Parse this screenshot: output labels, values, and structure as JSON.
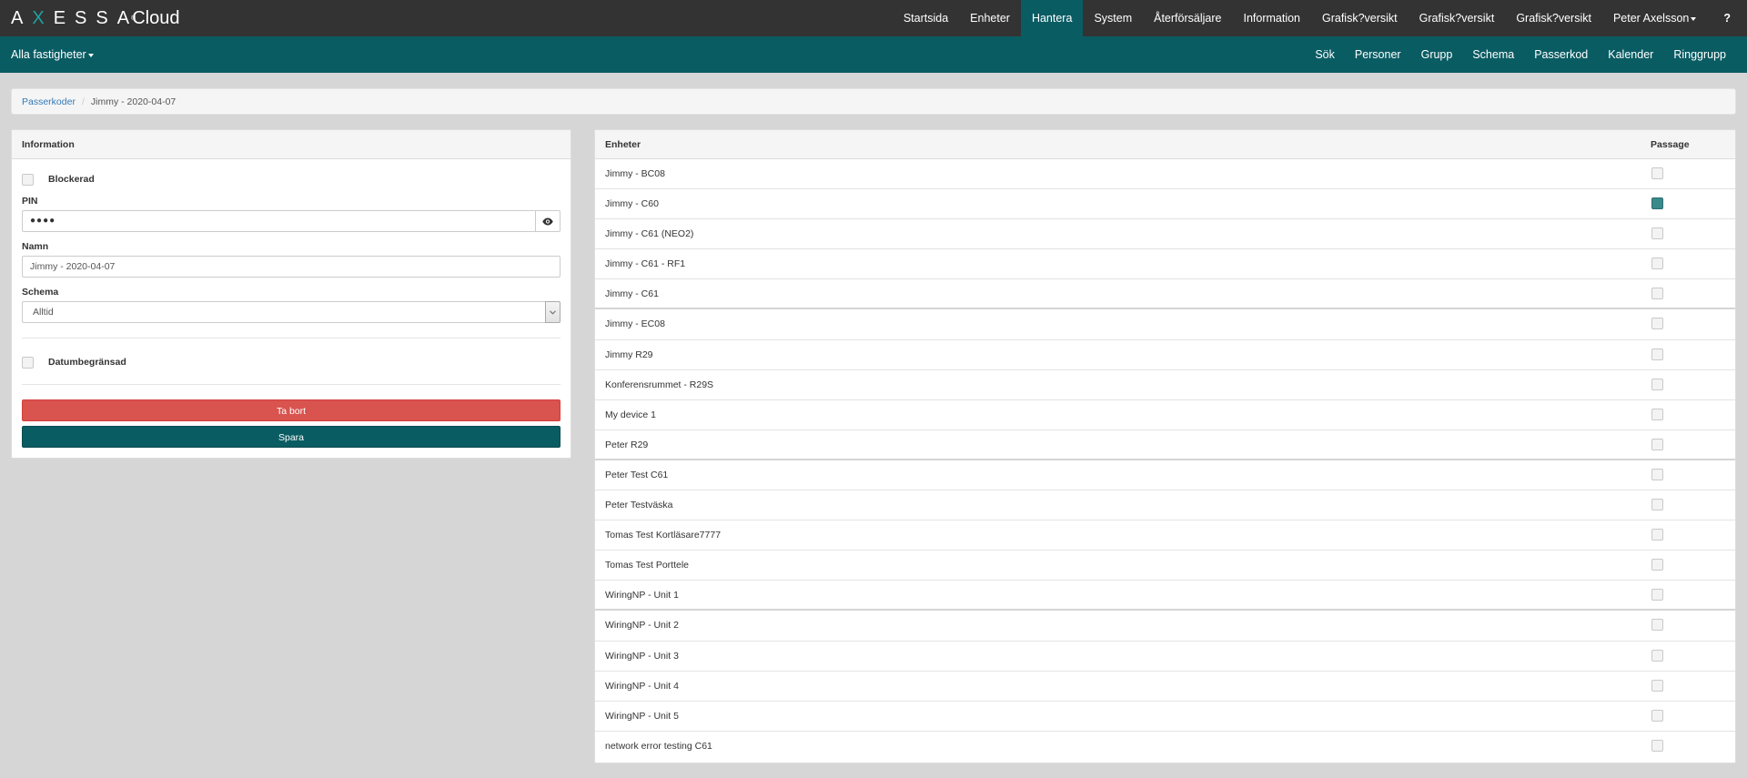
{
  "brand": {
    "logo_pre": "A",
    "logo_x": "X",
    "logo_post": "ESSA",
    "reg": "®",
    "cloud": "Cloud"
  },
  "topnav": {
    "items": [
      {
        "label": "Startsida"
      },
      {
        "label": "Enheter"
      },
      {
        "label": "Hantera",
        "active": true
      },
      {
        "label": "System"
      },
      {
        "label": "Återförsäljare"
      },
      {
        "label": "Information"
      },
      {
        "label": "Grafisk?versikt"
      },
      {
        "label": "Grafisk?versikt"
      },
      {
        "label": "Grafisk?versikt"
      },
      {
        "label": "Peter Axelsson"
      },
      {
        "label": "?"
      }
    ]
  },
  "subnav": {
    "property_selector": "Alla fastigheter",
    "items": [
      {
        "label": "Sök"
      },
      {
        "label": "Personer"
      },
      {
        "label": "Grupp"
      },
      {
        "label": "Schema"
      },
      {
        "label": "Passerkod"
      },
      {
        "label": "Kalender"
      },
      {
        "label": "Ringgrupp"
      }
    ]
  },
  "breadcrumb": {
    "parent": "Passerkoder",
    "separator": "/",
    "current": "Jimmy - 2020-04-07"
  },
  "info_panel": {
    "title": "Information",
    "blocked_label": "Blockerad",
    "blocked_checked": false,
    "pin_label": "PIN",
    "pin_value": "●●●●",
    "name_label": "Namn",
    "name_value": "Jimmy - 2020-04-07",
    "schedule_label": "Schema",
    "schedule_value": "Alltid",
    "date_limited_label": "Datumbegränsad",
    "date_limited_checked": false,
    "delete_label": "Ta bort",
    "save_label": "Spara"
  },
  "devices_panel": {
    "col_devices": "Enheter",
    "col_passage": "Passage",
    "rows": [
      {
        "name": "Jimmy - BC08",
        "passage": false
      },
      {
        "name": "Jimmy - C60",
        "passage": true
      },
      {
        "name": "Jimmy - C61 (NEO2)",
        "passage": false
      },
      {
        "name": "Jimmy - C61 - RF1",
        "passage": false
      },
      {
        "name": "Jimmy - C61",
        "passage": false
      },
      {
        "name": "Jimmy - EC08",
        "passage": false
      },
      {
        "name": "Jimmy R29",
        "passage": false
      },
      {
        "name": "Konferensrummet - R29S",
        "passage": false
      },
      {
        "name": "My device 1",
        "passage": false
      },
      {
        "name": "Peter R29",
        "passage": false
      },
      {
        "name": "Peter Test C61",
        "passage": false
      },
      {
        "name": "Peter Testväska",
        "passage": false
      },
      {
        "name": "Tomas Test Kortläsare7777",
        "passage": false
      },
      {
        "name": "Tomas Test Porttele",
        "passage": false
      },
      {
        "name": "WiringNP - Unit 1",
        "passage": false
      },
      {
        "name": "WiringNP - Unit 2",
        "passage": false
      },
      {
        "name": "WiringNP - Unit 3",
        "passage": false
      },
      {
        "name": "WiringNP - Unit 4",
        "passage": false
      },
      {
        "name": "WiringNP - Unit 5",
        "passage": false
      },
      {
        "name": "network error testing C61",
        "passage": false
      }
    ]
  },
  "colors": {
    "dark_bar": "#333333",
    "teal": "#0a5c63",
    "danger": "#d9534f",
    "checked": "#3b8a8b"
  }
}
